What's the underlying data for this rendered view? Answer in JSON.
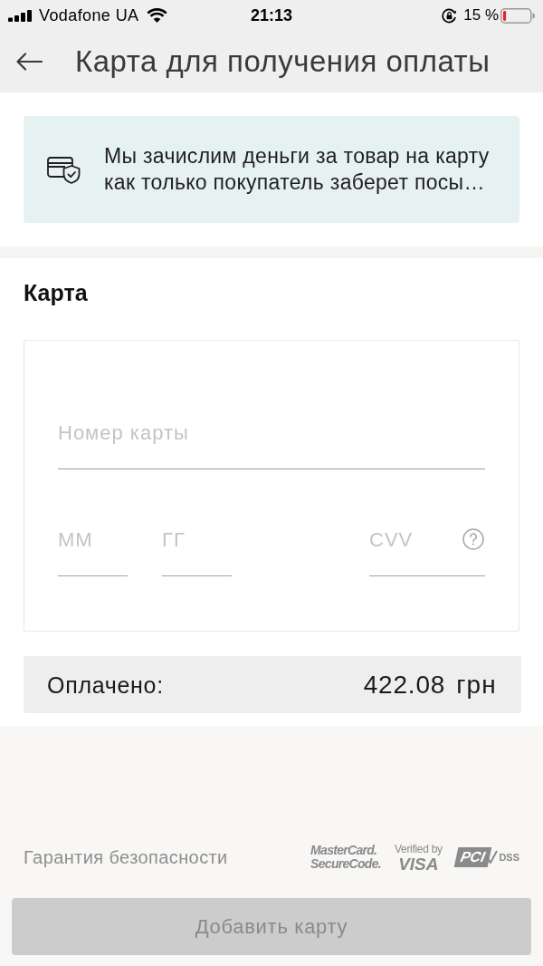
{
  "status_bar": {
    "carrier": "Vodafone UA",
    "time": "21:13",
    "battery": "15 %"
  },
  "header": {
    "title": "Карта для получения оплаты"
  },
  "notice": {
    "lines": [
      "Мы зачислим деньги за товар на карту",
      "как только покупатель заберет посы…"
    ]
  },
  "card_section": {
    "title": "Карта",
    "fields": [
      {
        "kind": "number",
        "placeholder": "Номер карты"
      },
      {
        "kind": "month",
        "placeholder": "ММ"
      },
      {
        "kind": "year",
        "placeholder": "ГГ"
      },
      {
        "kind": "cvv",
        "placeholder": "CVV"
      }
    ]
  },
  "total": {
    "label": "Оплачено:",
    "amount": "422.08",
    "currency": "грн"
  },
  "security": {
    "label": "Гарантия безопасности",
    "logos": [
      {
        "kind": "mastercard",
        "lines": [
          "MasterCard.",
          "SecureCode."
        ]
      },
      {
        "kind": "visa",
        "lines": [
          "Verified by",
          "VISA"
        ]
      },
      {
        "kind": "pci",
        "lines": [
          "PCI",
          "DSS"
        ]
      }
    ]
  },
  "add_button": {
    "label": "Добавить карту",
    "disabled": true
  }
}
